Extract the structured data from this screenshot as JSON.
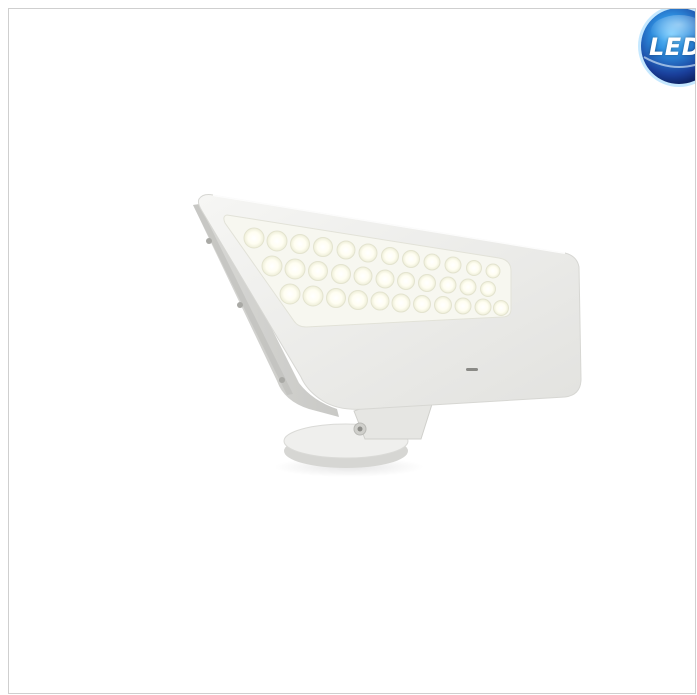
{
  "image": {
    "subject": "product-photo",
    "background_color": "#ffffff",
    "border_color": "#cfcfcf",
    "fixture_color": "#efefed",
    "led_color": "#fffef2"
  },
  "badge": {
    "text": "LED",
    "colors": [
      "#1a3f9b",
      "#2d8fe0",
      "#0b1b55"
    ]
  }
}
